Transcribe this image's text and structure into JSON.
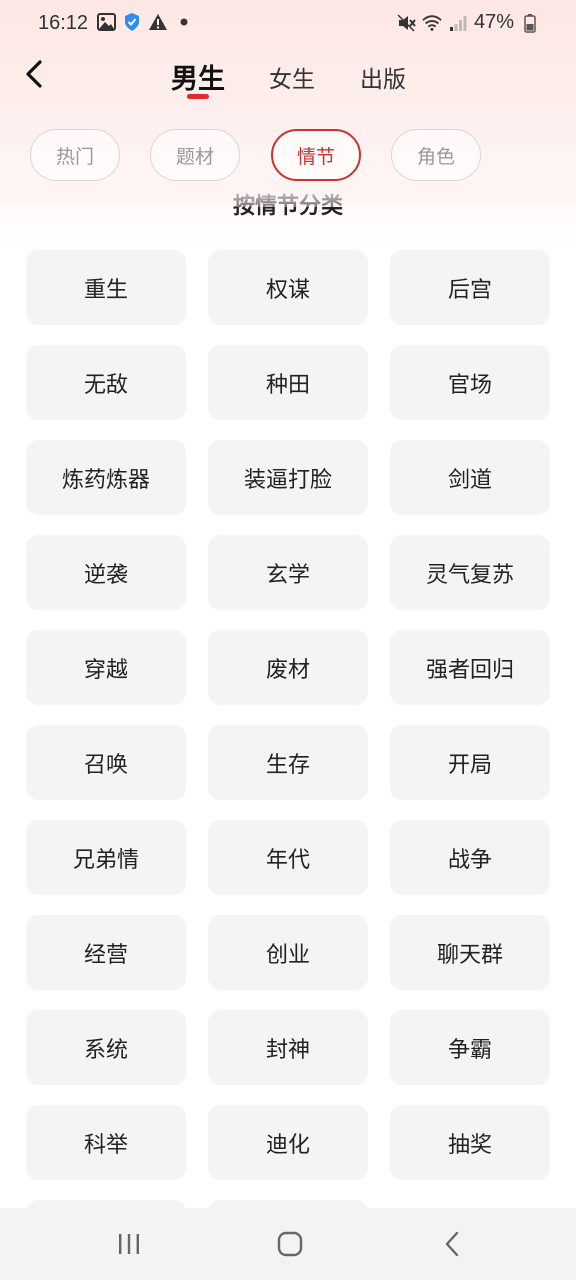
{
  "status_bar": {
    "time": "16:12",
    "battery": "47%",
    "left_icons": [
      "image-icon",
      "shield-check-icon",
      "warning-icon",
      "dot-icon"
    ],
    "right_icons": [
      "mute-icon",
      "wifi-icon",
      "signal-icon",
      "battery-icon"
    ]
  },
  "header": {
    "back_icon": "chevron-left-icon",
    "tabs": [
      {
        "label": "男生",
        "active": true
      },
      {
        "label": "女生",
        "active": false
      },
      {
        "label": "出版",
        "active": false
      }
    ],
    "accent_color": "#e12b2b"
  },
  "filters": [
    {
      "label": "热门",
      "active": false
    },
    {
      "label": "题材",
      "active": false
    },
    {
      "label": "情节",
      "active": true
    },
    {
      "label": "角色",
      "active": false
    }
  ],
  "section_title": "按情节分类",
  "tags": [
    "重生",
    "权谋",
    "后宫",
    "无敌",
    "种田",
    "官场",
    "炼药炼器",
    "装逼打脸",
    "剑道",
    "逆袭",
    "玄学",
    "灵气复苏",
    "穿越",
    "废材",
    "强者回归",
    "召唤",
    "生存",
    "开局",
    "兄弟情",
    "年代",
    "战争",
    "经营",
    "创业",
    "聊天群",
    "系统",
    "封神",
    "争霸",
    "科举",
    "迪化",
    "抽奖",
    "",
    ""
  ],
  "nav_bar": {
    "icons": [
      "recent-apps-icon",
      "home-icon",
      "back-icon"
    ]
  }
}
